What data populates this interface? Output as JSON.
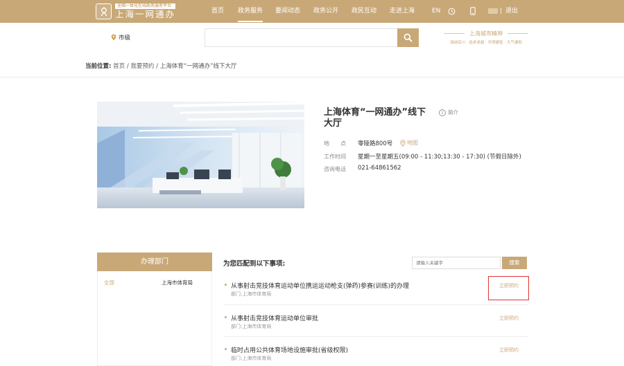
{
  "header": {
    "logo_sub": "全国一体化在线政务服务平台",
    "logo_title": "上海一网通办",
    "nav": [
      "首页",
      "政务服务",
      "要闻动态",
      "政务公开",
      "政民互动",
      "走进上海"
    ],
    "active_nav": "政务服务",
    "lang": "EN",
    "logout": "退出",
    "separator": "|"
  },
  "search": {
    "location": "市级",
    "placeholder": ""
  },
  "promo": {
    "title": "上海城市精神",
    "tags": "海纳百川 · 追求卓越 · 开明睿智 · 大气谦和"
  },
  "breadcrumb": {
    "label": "当前位置:",
    "items": [
      "首页",
      "我要预约",
      "上海体育“一网通办”线下大厅"
    ],
    "sep": " / "
  },
  "hall": {
    "name": "上海体育“一网通办”线下大厅",
    "intro": "简介",
    "address_label": "地　　点",
    "address": "零陵路800号",
    "map_link": "地图",
    "hours_label": "工作时间",
    "hours": "星期一至星期五(09:00 - 11:30;13:30 - 17:30) (节假日除外)",
    "phone_label": "咨询电话",
    "phone": "021-64861562"
  },
  "dept": {
    "title": "办理部门",
    "all": "全部",
    "name": "上海市体育局"
  },
  "results": {
    "title": "为您匹配到以下事项:",
    "keyword_placeholder": "请输入关键字",
    "search_btn": "搜索",
    "items": [
      {
        "title": "从事射击竞技体育运动单位携运运动枪支(弹药)参赛(训练)的办理",
        "dept": "部门:上海市体育局",
        "button": "立即预约"
      },
      {
        "title": "从事射击竞技体育运动单位审批",
        "dept": "部门:上海市体育局",
        "button": "立即预约"
      },
      {
        "title": "临时占用公共体育场地设施审批(省级权限)",
        "dept": "部门:上海市体育局",
        "button": "立即预约"
      }
    ]
  },
  "colors": {
    "brand": "#c9a877",
    "highlight": "#e23333"
  }
}
